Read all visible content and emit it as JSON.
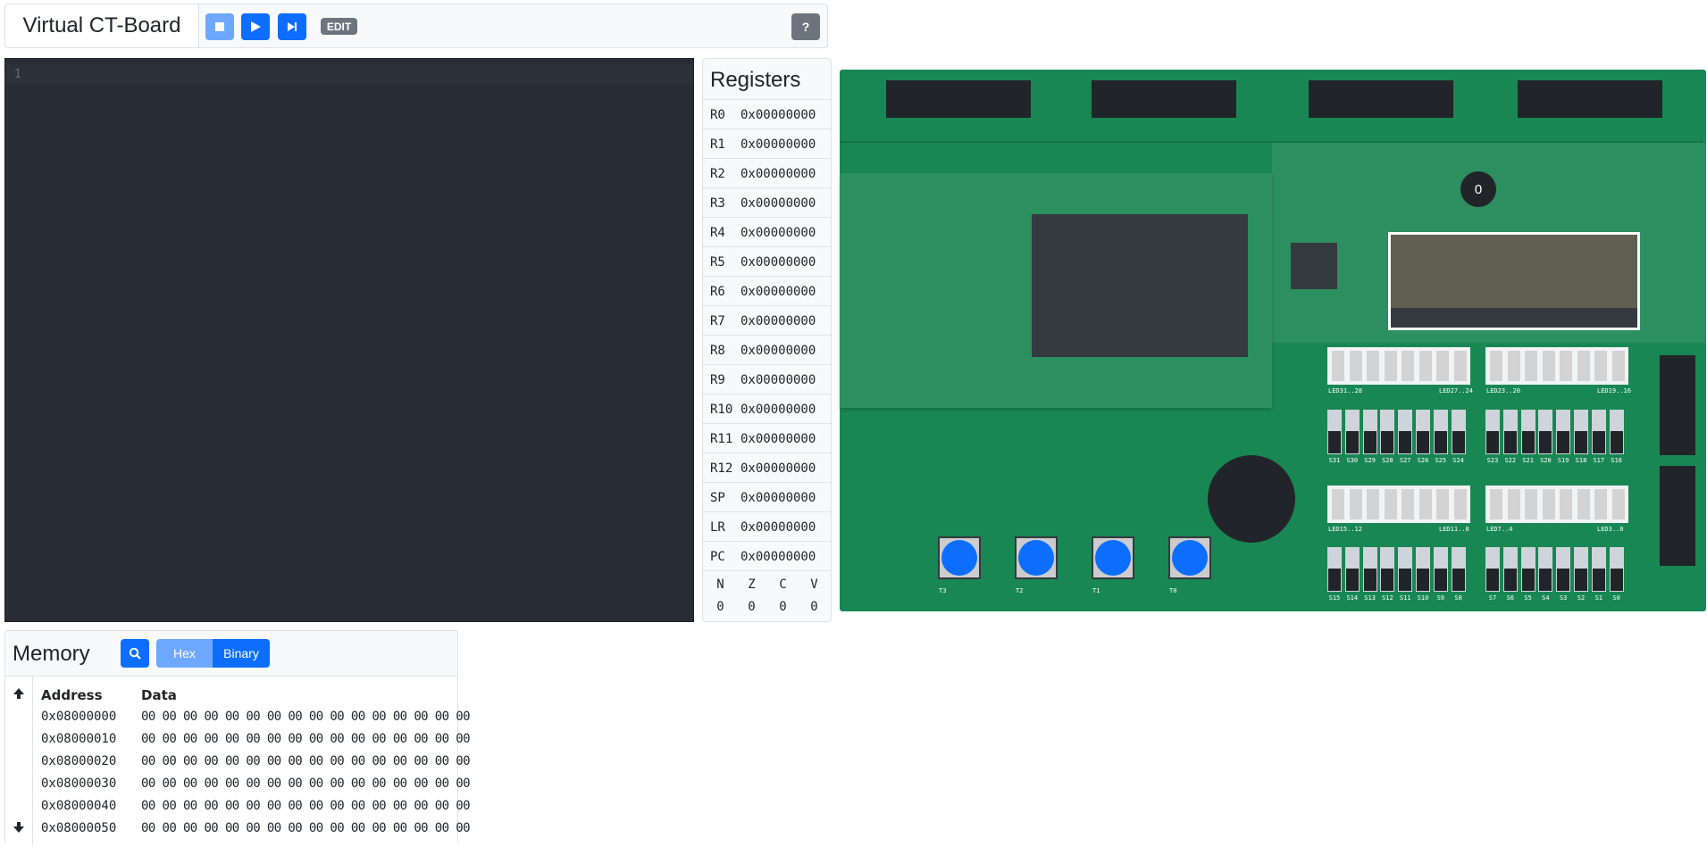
{
  "header": {
    "title": "Virtual CT-Board",
    "stop_icon": "stop-icon",
    "run_icon": "play-icon",
    "step_icon": "step-forward-icon",
    "edit_label": "EDIT",
    "help_label": "?"
  },
  "editor": {
    "line_number": "1"
  },
  "registers": {
    "title": "Registers",
    "rows": [
      {
        "name": "R0",
        "value": "0x00000000"
      },
      {
        "name": "R1",
        "value": "0x00000000"
      },
      {
        "name": "R2",
        "value": "0x00000000"
      },
      {
        "name": "R3",
        "value": "0x00000000"
      },
      {
        "name": "R4",
        "value": "0x00000000"
      },
      {
        "name": "R5",
        "value": "0x00000000"
      },
      {
        "name": "R6",
        "value": "0x00000000"
      },
      {
        "name": "R7",
        "value": "0x00000000"
      },
      {
        "name": "R8",
        "value": "0x00000000"
      },
      {
        "name": "R9",
        "value": "0x00000000"
      },
      {
        "name": "R10",
        "value": "0x00000000"
      },
      {
        "name": "R11",
        "value": "0x00000000"
      },
      {
        "name": "R12",
        "value": "0x00000000"
      },
      {
        "name": "SP",
        "value": "0x00000000"
      },
      {
        "name": "LR",
        "value": "0x00000000"
      },
      {
        "name": "PC",
        "value": "0x00000000"
      }
    ],
    "flags": [
      {
        "name": "N",
        "value": "0"
      },
      {
        "name": "Z",
        "value": "0"
      },
      {
        "name": "C",
        "value": "0"
      },
      {
        "name": "V",
        "value": "0"
      }
    ]
  },
  "memory": {
    "title": "Memory",
    "hex_label": "Hex",
    "binary_label": "Binary",
    "address_header": "Address",
    "data_header": "Data",
    "rows": [
      {
        "address": "0x08000000",
        "data": "00 00 00 00 00 00 00 00 00 00 00 00 00 00 00 00"
      },
      {
        "address": "0x08000010",
        "data": "00 00 00 00 00 00 00 00 00 00 00 00 00 00 00 00"
      },
      {
        "address": "0x08000020",
        "data": "00 00 00 00 00 00 00 00 00 00 00 00 00 00 00 00"
      },
      {
        "address": "0x08000030",
        "data": "00 00 00 00 00 00 00 00 00 00 00 00 00 00 00 00"
      },
      {
        "address": "0x08000040",
        "data": "00 00 00 00 00 00 00 00 00 00 00 00 00 00 00 00"
      },
      {
        "address": "0x08000050",
        "data": "00 00 00 00 00 00 00 00 00 00 00 00 00 00 00 00"
      }
    ]
  },
  "board": {
    "counter_value": "0",
    "buttons": [
      "T3",
      "T2",
      "T1",
      "T0"
    ],
    "led_banks": [
      {
        "left_label": "LED31..28",
        "right_label": "LED27..24"
      },
      {
        "left_label": "LED23..20",
        "right_label": "LED19..16"
      },
      {
        "left_label": "LED15..12",
        "right_label": "LED11..8"
      },
      {
        "left_label": "LED7..4",
        "right_label": "LED3..0"
      }
    ],
    "switches_upper_left": [
      "S31",
      "S30",
      "S29",
      "S28",
      "S27",
      "S26",
      "S25",
      "S24"
    ],
    "switches_upper_right": [
      "S23",
      "S22",
      "S21",
      "S20",
      "S19",
      "S18",
      "S17",
      "S16"
    ],
    "switches_lower_left": [
      "S15",
      "S14",
      "S13",
      "S12",
      "S11",
      "S10",
      "S9",
      "S8"
    ],
    "switches_lower_right": [
      "S7",
      "S6",
      "S5",
      "S4",
      "S3",
      "S2",
      "S1",
      "S0"
    ]
  }
}
